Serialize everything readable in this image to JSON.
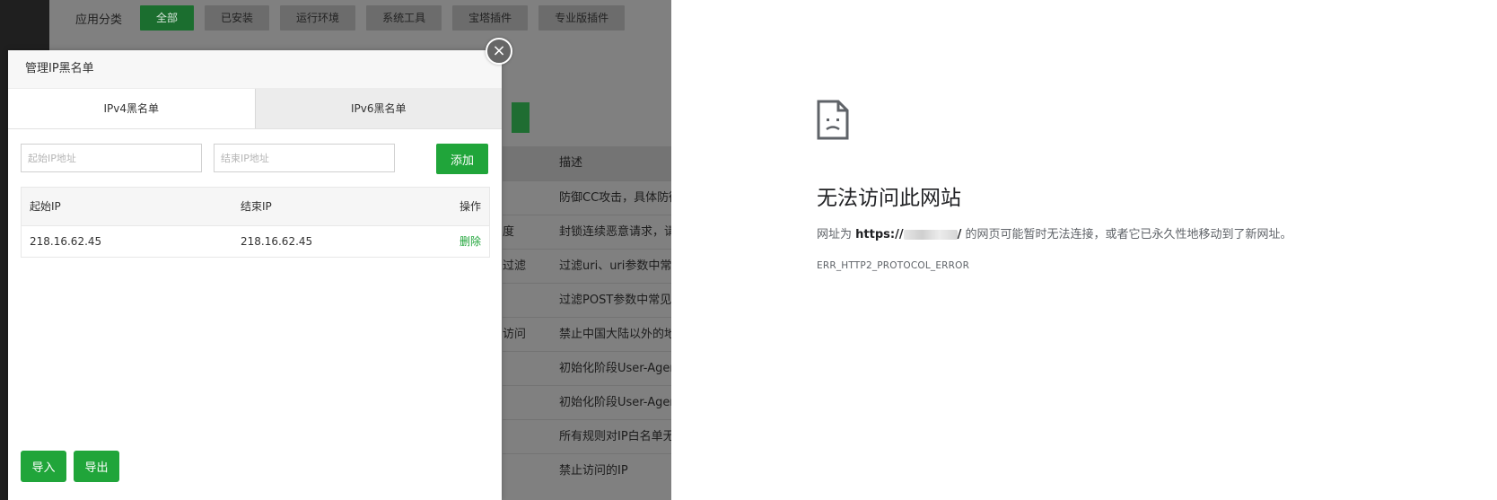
{
  "background_app": {
    "category_label": "应用分类",
    "categories": [
      {
        "label": "全部",
        "active": true
      },
      {
        "label": "已安装",
        "active": false
      },
      {
        "label": "运行环境",
        "active": false
      },
      {
        "label": "系统工具",
        "active": false
      },
      {
        "label": "宝塔插件",
        "active": false
      },
      {
        "label": "专业版插件",
        "active": false
      }
    ],
    "table_header": "描述",
    "rows": [
      {
        "a": "",
        "b": "防御CC攻击，具体防御"
      },
      {
        "a": "度",
        "b": "封锁连续恶意请求，请"
      },
      {
        "a": "过滤",
        "b": "过滤uri、uri参数中常见"
      },
      {
        "a": "",
        "b": "过滤POST参数中常见"
      },
      {
        "a": "访问",
        "b": "禁止中国大陆以外的地"
      },
      {
        "a": "",
        "b": "初始化阶段User-Agent"
      },
      {
        "a": "",
        "b": "初始化阶段User-Agent"
      },
      {
        "a": "",
        "b": "所有规则对IP白名单无"
      },
      {
        "a": "",
        "b": "禁止访问的IP"
      }
    ]
  },
  "modal": {
    "title": "管理IP黑名单",
    "close_symbol": "×",
    "tabs": [
      {
        "label": "IPv4黑名单",
        "active": true
      },
      {
        "label": "IPv6黑名单",
        "active": false
      }
    ],
    "start_ip_placeholder": "起始IP地址",
    "end_ip_placeholder": "结束IP地址",
    "add_label": "添加",
    "table": {
      "headers": {
        "start": "起始IP",
        "end": "结束IP",
        "action": "操作"
      },
      "rows": [
        {
          "start": "218.16.62.45",
          "end": "218.16.62.45",
          "action": "删除"
        }
      ]
    },
    "import_label": "导入",
    "export_label": "导出"
  },
  "error_page": {
    "title": "无法访问此网站",
    "desc_prefix": "网址为 ",
    "url_shown": "https://",
    "url_suffix": "/",
    "desc_suffix": " 的网页可能暂时无法连接，或者它已永久性地移动到了新网址。",
    "error_code": "ERR_HTTP2_PROTOCOL_ERROR",
    "icon": "sad-document-icon"
  },
  "colors": {
    "accent_green": "#20a53a",
    "overlay_gray": "#808080"
  }
}
